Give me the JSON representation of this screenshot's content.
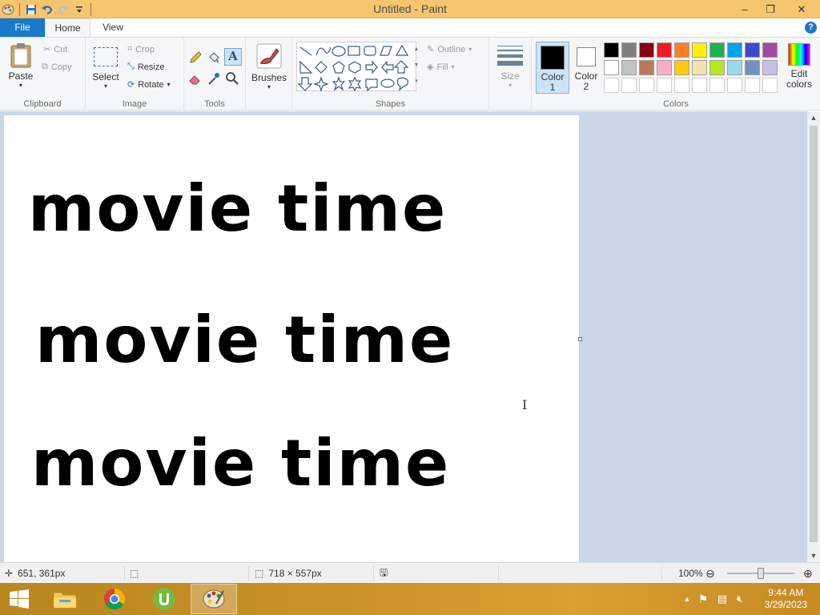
{
  "window": {
    "title": "Untitled - Paint",
    "minimize": "–",
    "maximize": "❐",
    "close": "✕"
  },
  "tabs": {
    "file": "File",
    "home": "Home",
    "view": "View",
    "help": "?"
  },
  "ribbon": {
    "clipboard": {
      "paste": "Paste",
      "cut": "Cut",
      "copy": "Copy",
      "group": "Clipboard"
    },
    "image": {
      "select": "Select",
      "crop": "Crop",
      "resize": "Resize",
      "rotate": "Rotate",
      "group": "Image"
    },
    "tools": {
      "group": "Tools"
    },
    "brushes": {
      "label": "Brushes"
    },
    "shapes": {
      "outline": "Outline",
      "fill": "Fill",
      "group": "Shapes"
    },
    "size": {
      "label": "Size"
    },
    "colors": {
      "color1_label": "Color",
      "color1_num": "1",
      "color2_label": "Color",
      "color2_num": "2",
      "edit": "Edit",
      "edit2": "colors",
      "group": "Colors",
      "color1": "#000000",
      "color2": "#ffffff",
      "palette_row1": [
        "#000000",
        "#7f7f7f",
        "#880015",
        "#ed1c24",
        "#ff7f27",
        "#fff200",
        "#22b14c",
        "#00a2e8",
        "#3f48cc",
        "#a349a4"
      ],
      "palette_row2": [
        "#ffffff",
        "#c3c3c3",
        "#b97a57",
        "#ffaec9",
        "#ffc90e",
        "#efe4b0",
        "#b5e61d",
        "#99d9ea",
        "#7092be",
        "#c8bfe7"
      ]
    }
  },
  "canvas": {
    "lines": [
      "movie time",
      "movie time",
      "movie time"
    ]
  },
  "status": {
    "cursor_pos": "651, 361px",
    "canvas_size": "718 × 557px",
    "zoom": "100%"
  },
  "taskbar": {
    "time": "9:44 AM",
    "date": "3/29/2023"
  }
}
